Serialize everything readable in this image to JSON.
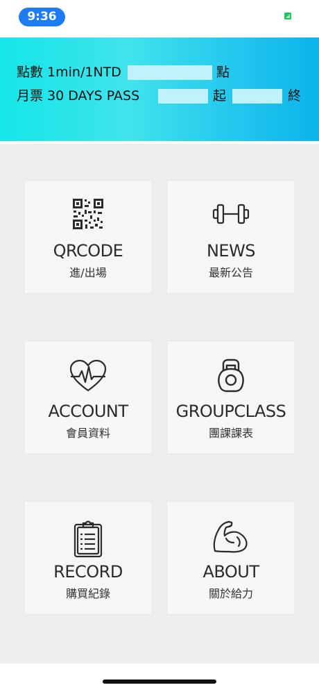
{
  "status_bar": {
    "time": "9:36"
  },
  "banner": {
    "row1": {
      "label": "點數 1min/1NTD",
      "suffix": "點"
    },
    "row2": {
      "label": "月票 30 DAYS PASS",
      "start": "起",
      "end": "終"
    }
  },
  "menu": [
    {
      "title": "QRCODE",
      "subtitle": "進/出場",
      "icon": "qrcode-icon"
    },
    {
      "title": "NEWS",
      "subtitle": "最新公告",
      "icon": "dumbbell-icon"
    },
    {
      "title": "ACCOUNT",
      "subtitle": "會員資料",
      "icon": "heartbeat-icon"
    },
    {
      "title": "GROUPCLASS",
      "subtitle": "團課課表",
      "icon": "kettlebell-icon"
    },
    {
      "title": "RECORD",
      "subtitle": "購買紀錄",
      "icon": "clipboard-icon"
    },
    {
      "title": "ABOUT",
      "subtitle": "關於給力",
      "icon": "bicep-icon"
    }
  ],
  "colors": {
    "accent": "#1e7cf2",
    "banner_start": "#14e6e8",
    "banner_end": "#0bb4ea",
    "battery": "#22c55e"
  }
}
